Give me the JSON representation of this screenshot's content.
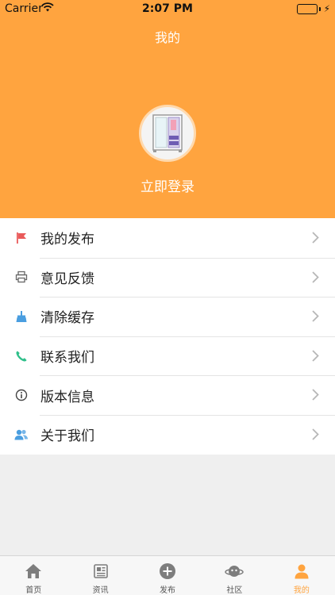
{
  "status_bar": {
    "carrier": "Carrier",
    "time": "2:07 PM"
  },
  "header": {
    "title": "我的",
    "login_label": "立即登录"
  },
  "menu": {
    "items": [
      {
        "label": "我的发布",
        "icon": "flag-icon"
      },
      {
        "label": "意见反馈",
        "icon": "printer-icon"
      },
      {
        "label": "清除缓存",
        "icon": "broom-icon"
      },
      {
        "label": "联系我们",
        "icon": "phone-icon"
      },
      {
        "label": "版本信息",
        "icon": "info-icon"
      },
      {
        "label": "关于我们",
        "icon": "users-icon"
      }
    ]
  },
  "tabbar": {
    "tabs": [
      {
        "label": "首页",
        "icon": "home-icon"
      },
      {
        "label": "资讯",
        "icon": "news-icon"
      },
      {
        "label": "发布",
        "icon": "plus-icon"
      },
      {
        "label": "社区",
        "icon": "planet-icon"
      },
      {
        "label": "我的",
        "icon": "person-icon"
      }
    ],
    "active_index": 4
  },
  "colors": {
    "accent": "#ffa43f",
    "background": "#efefef"
  }
}
